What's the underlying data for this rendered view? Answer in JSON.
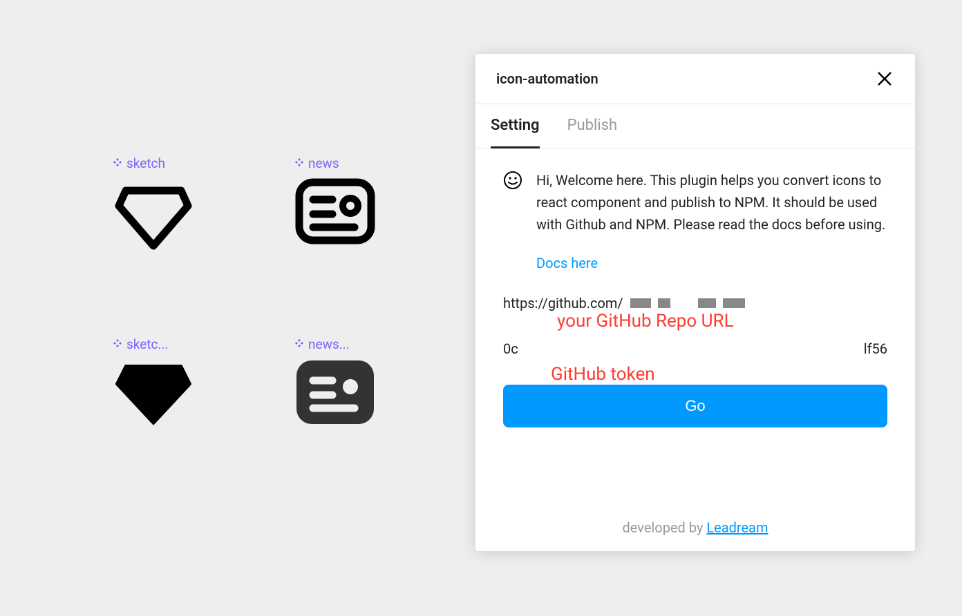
{
  "canvas": {
    "icons": [
      {
        "label": "sketch"
      },
      {
        "label": "news"
      },
      {
        "label": "sketc..."
      },
      {
        "label": "news..."
      }
    ]
  },
  "panel": {
    "title": "icon-automation",
    "tabs": {
      "setting": "Setting",
      "publish": "Publish"
    },
    "welcome": "Hi, Welcome here. This plugin helps you convert icons to react component and publish to NPM. It should be used with Github and NPM. Please read the docs before using.",
    "docs_link": "Docs here",
    "annotations": {
      "repo": "your GitHub Repo URL",
      "token": "GitHub token"
    },
    "repo_url_prefix": "https://github.com/",
    "token_prefix": "0c",
    "token_suffix": "lf56",
    "go_button": "Go",
    "footer": {
      "text": "developed by ",
      "link": "Leadream"
    }
  }
}
